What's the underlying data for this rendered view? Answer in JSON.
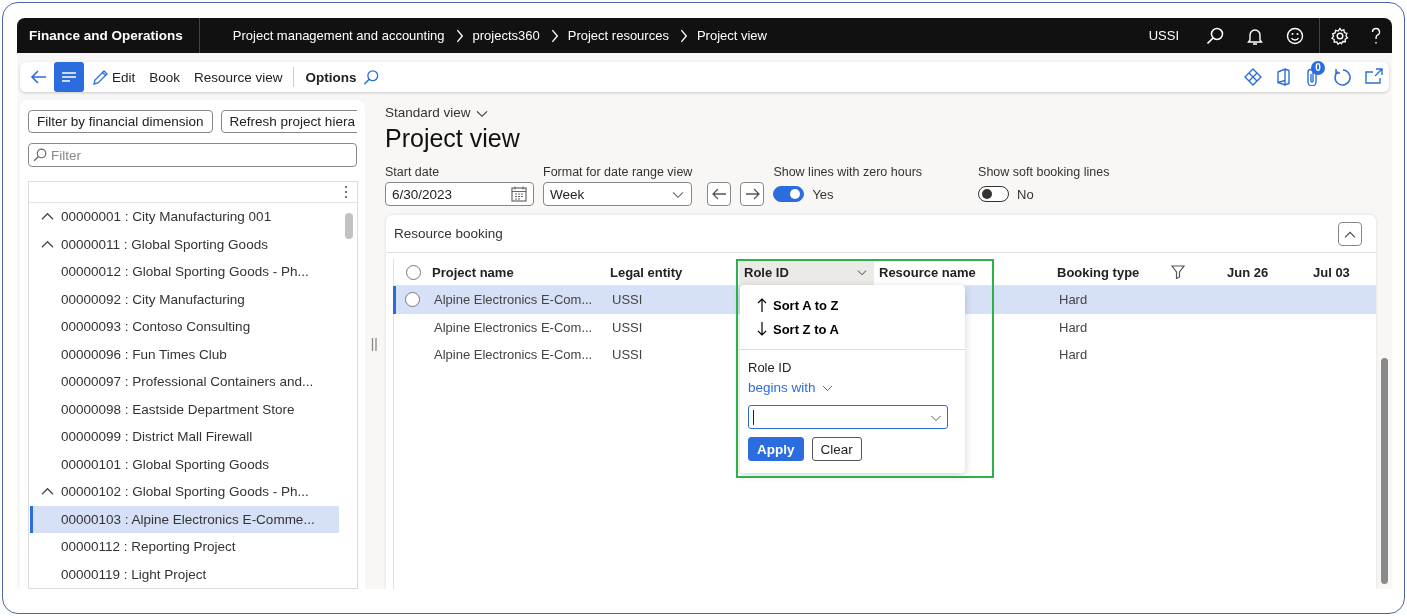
{
  "top_bar": {
    "app_name": "Finance and Operations",
    "breadcrumbs": [
      "Project management and accounting",
      "projects360",
      "Project resources",
      "Project view"
    ],
    "company": "USSI"
  },
  "toolbar": {
    "action_pane_toggle": {
      "selected": true
    },
    "items": [
      {
        "label": "Edit",
        "kind": "edit"
      },
      {
        "label": "Book",
        "kind": "plain"
      },
      {
        "label": "Resource view",
        "kind": "plain"
      },
      {
        "label": "Options",
        "kind": "tab"
      }
    ],
    "attachments_badge": "0"
  },
  "tree_pane": {
    "buttons": [
      "Filter by financial dimension",
      "Refresh project hiera"
    ],
    "filter": {
      "placeholder": "Filter"
    },
    "items": [
      {
        "label": "00000001 : City Manufacturing 001",
        "kind": "parent",
        "selected": false
      },
      {
        "label": "00000011 : Global Sporting Goods",
        "kind": "parent",
        "selected": false
      },
      {
        "label": "00000012 : Global Sporting Goods - Ph...",
        "kind": "leaf",
        "selected": false
      },
      {
        "label": "00000092 : City Manufacturing",
        "kind": "leaf",
        "selected": false
      },
      {
        "label": "00000093 : Contoso Consulting",
        "kind": "leaf",
        "selected": false
      },
      {
        "label": "00000096 : Fun Times Club",
        "kind": "leaf",
        "selected": false
      },
      {
        "label": "00000097 : Professional Containers and...",
        "kind": "leaf",
        "selected": false
      },
      {
        "label": "00000098 : Eastside Department Store",
        "kind": "leaf",
        "selected": false
      },
      {
        "label": "00000099 : District Mall Firewall",
        "kind": "leaf",
        "selected": false
      },
      {
        "label": "00000101 : Global Sporting Goods",
        "kind": "leaf",
        "selected": false
      },
      {
        "label": "00000102 : Global Sporting Goods - Ph...",
        "kind": "parent",
        "selected": false
      },
      {
        "label": "00000103 : Alpine Electronics E-Comme...",
        "kind": "leaf",
        "selected": true
      },
      {
        "label": "00000112 : Reporting Project",
        "kind": "leaf",
        "selected": false
      },
      {
        "label": "00000119 : Light Project",
        "kind": "leaf",
        "selected": false
      }
    ]
  },
  "main": {
    "view_selector": "Standard view",
    "title": "Project view",
    "start_date": {
      "label": "Start date",
      "value": "6/30/2023"
    },
    "date_range_format": {
      "label": "Format for date range view",
      "value": "Week"
    },
    "toggles": [
      {
        "label": "Show lines with zero hours",
        "on": true,
        "value": "Yes"
      },
      {
        "label": "Show soft booking lines",
        "on": false,
        "value": "No"
      }
    ],
    "resource_booking": {
      "title": "Resource booking",
      "select_all": {
        "checked": false
      },
      "columns": [
        {
          "label": "Project name",
          "active": false
        },
        {
          "label": "Legal entity",
          "active": false
        },
        {
          "label": "Role ID",
          "active": true
        },
        {
          "label": "Resource name",
          "active": false
        },
        {
          "label": "Booking type",
          "active": false
        },
        {
          "label": "Jun 26",
          "active": false
        },
        {
          "label": "Jul 03",
          "active": false
        }
      ],
      "rows": [
        {
          "selected": true,
          "checked": false,
          "project_name": "Alpine Electronics E-Com...",
          "legal_entity": "USSI",
          "booking_type": "Hard"
        },
        {
          "selected": false,
          "checked": false,
          "project_name": "Alpine Electronics E-Com...",
          "legal_entity": "USSI",
          "booking_type": "Hard"
        },
        {
          "selected": false,
          "checked": false,
          "project_name": "Alpine Electronics E-Com...",
          "legal_entity": "USSI",
          "booking_type": "Hard"
        }
      ],
      "column_menu": {
        "sort_options": [
          {
            "label": "Sort A to Z",
            "kind": "ascending"
          },
          {
            "label": "Sort Z to A",
            "kind": "descending"
          }
        ],
        "field_label": "Role ID",
        "operator": "begins with",
        "buttons": [
          {
            "label": "Apply",
            "kind": "primary"
          },
          {
            "label": "Clear",
            "kind": "secondary"
          }
        ]
      }
    }
  }
}
